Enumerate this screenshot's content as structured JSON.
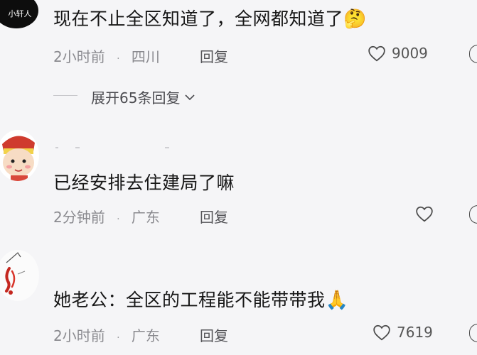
{
  "comments": [
    {
      "avatar": {
        "text": "小轩人"
      },
      "text": "现在不止全区知道了，全网都知道了",
      "emoji": "🤔",
      "time": "2小时前",
      "location": "四川",
      "reply_label": "回复",
      "likes": "9009",
      "expand_label": "展开65条回复"
    },
    {
      "avatar": {
        "text": ""
      },
      "text": "已经安排去住建局了嘛",
      "time": "2分钟前",
      "location": "广东",
      "reply_label": "回复",
      "likes": ""
    },
    {
      "avatar": {
        "text": ""
      },
      "text": "她老公：全区的工程能不能带带我",
      "emoji": "🙏",
      "time": "2小时前",
      "location": "广东",
      "reply_label": "回复",
      "likes": "7619"
    }
  ],
  "separator": "·",
  "icons": {
    "like": "heart-outline-icon",
    "expand": "chevron-down-icon"
  },
  "colors": {
    "background": "#f5f5f7",
    "meta": "#8a8a8f",
    "text": "#161616"
  }
}
